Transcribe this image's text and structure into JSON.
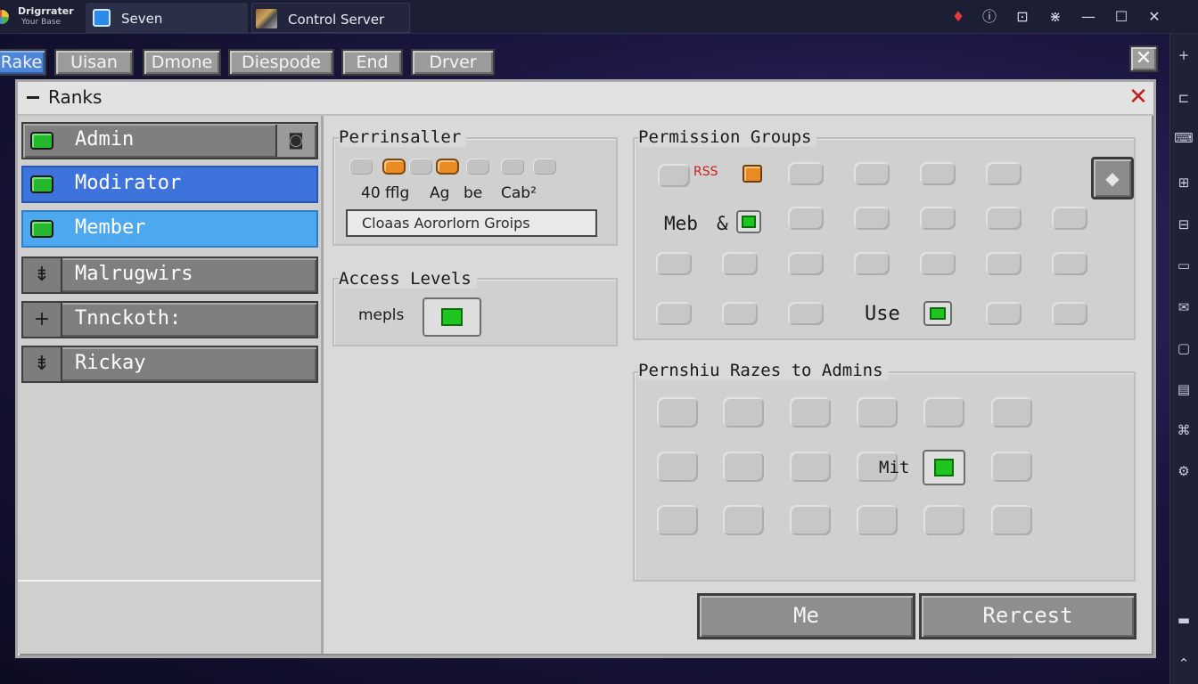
{
  "titlebar": {
    "logo_line1": "Drigrrater",
    "logo_line2": "Your Base",
    "tabs": [
      {
        "label": "Seven"
      },
      {
        "label": "Control Server"
      }
    ]
  },
  "game_tabs": [
    {
      "label": "Rake",
      "active": true
    },
    {
      "label": "Uisan"
    },
    {
      "label": "Dmone"
    },
    {
      "label": "Diespode"
    },
    {
      "label": "End"
    },
    {
      "label": "Drver"
    }
  ],
  "window": {
    "title": "Ranks",
    "close_glyph": "✕"
  },
  "ranks": [
    {
      "label": "Admin",
      "state": "default"
    },
    {
      "label": "Modirator",
      "state": "selected"
    },
    {
      "label": "Member",
      "state": "hover"
    },
    {
      "label": "Malrugwirs",
      "state": "default"
    },
    {
      "label": "Tnnckoth:",
      "state": "default"
    },
    {
      "label": "Rickay",
      "state": "default"
    }
  ],
  "permissaller": {
    "title": "Perrinsaller",
    "labels": [
      "40 fflg",
      "Ag",
      "be",
      "Cab²"
    ],
    "dropdown_value": "Cloaas Aororlorn Groips"
  },
  "access_levels": {
    "title": "Access Levels",
    "item_label": "mepls",
    "enabled": true
  },
  "permission_groups": {
    "title": "Permission Groups",
    "row1_label": "RSS",
    "row2_label": "Meb",
    "row2_symbol": "&",
    "use_label": "Use"
  },
  "permission_razes": {
    "title": "Pernshiu Razes to Admins",
    "item_label": "Mit"
  },
  "buttons": {
    "me": "Me",
    "reset": "Rercest"
  },
  "colors": {
    "accent_blue": "#3f73dc",
    "selected_blue": "#4ea8f0",
    "toggle_green": "#1fc51f",
    "toggle_orange": "#e98a23",
    "alert_red": "#e23a3a"
  }
}
